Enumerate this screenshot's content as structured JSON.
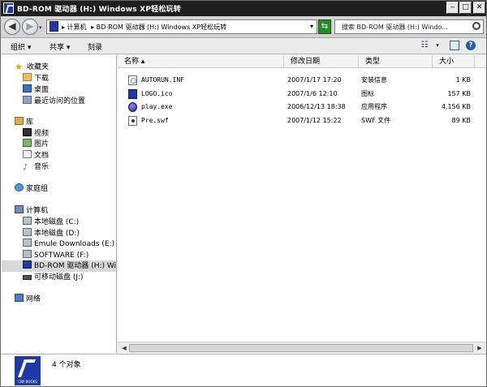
{
  "window": {
    "title": "BD-ROM 驱动器 (H:) Windows XP轻松玩转",
    "min_glyph": "‒",
    "max_glyph": "□",
    "close_glyph": "✕"
  },
  "address": {
    "back_glyph": "◀",
    "forward_glyph": "▶",
    "crumbs": [
      "▸ 计算机",
      "▸ BD-ROM 驱动器 (H:) Windows XP轻松玩转"
    ],
    "dropdown_glyph": "▾",
    "refresh_glyph": "⇆",
    "search_placeholder": "搜索 BD-ROM 驱动器 (H:) Windo..."
  },
  "toolbar": {
    "organize": "组织 ▾",
    "share": "共享 ▾",
    "burn": "刻录",
    "views_glyph": "☷",
    "views_dd_glyph": "▾",
    "preview_glyph": "",
    "help_glyph": "?"
  },
  "nav": {
    "favorites": "收藏夹",
    "downloads": "下载",
    "desktop": "桌面",
    "recent": "最近访问的位置",
    "libraries": "库",
    "videos": "视频",
    "pictures": "图片",
    "documents": "文档",
    "music": "音乐",
    "homegroup": "家庭组",
    "computer": "计算机",
    "drives": [
      "本地磁盘 (C:)",
      "本地磁盘 (D:)",
      "Emule Downloads (E:)",
      "SOFTWARE (F:)",
      "BD-ROM 驱动器 (H:) Windows XP轻松玩转",
      "可移动磁盘 (J:)"
    ],
    "network": "网络",
    "music_glyph": "♪",
    "star_glyph": "★"
  },
  "columns": {
    "name": "名称 ▴",
    "date": "修改日期",
    "type": "类型",
    "size": "大小"
  },
  "files": [
    {
      "name": "AUTORUN.INF",
      "date": "2007/1/17 17:20",
      "type": "安装信息",
      "size": "1 KB",
      "icon": "inf-icon"
    },
    {
      "name": "LOGO.ico",
      "date": "2007/1/6 12:10",
      "type": "图标",
      "size": "157 KB",
      "icon": "ico-icon"
    },
    {
      "name": "play.exe",
      "date": "2006/12/13 18:38",
      "type": "应用程序",
      "size": "4,156 KB",
      "icon": "exe-icon"
    },
    {
      "name": "Pre.swf",
      "date": "2007/1/12 15:22",
      "type": "SWF 文件",
      "size": "89 KB",
      "icon": "swf-icon"
    }
  ],
  "scrollbar": {
    "left_glyph": "◀",
    "right_glyph": "▶"
  },
  "details": {
    "count_text": "4 个对象",
    "logo_text": "CNP BOOKS"
  }
}
